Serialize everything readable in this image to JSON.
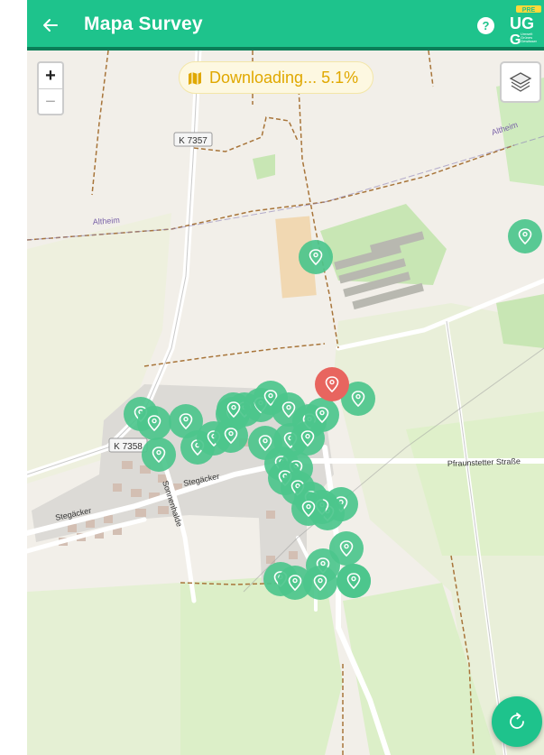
{
  "app": {
    "title": "Mapa Survey",
    "accent_color": "#1ec38c",
    "logo": {
      "badge": "PRE",
      "letters": "UG",
      "letter_g": "G",
      "tagline": "Umwelt Grünes Gewässer"
    }
  },
  "controls": {
    "zoom_in": "+",
    "zoom_out": "−",
    "help": "?",
    "download_status": "Downloading... 5.1%"
  },
  "map_labels": {
    "road_k7357": "K 7357",
    "road_k7358": "K 7358",
    "altheim_w": "Altheim",
    "altheim_ne": "Altheim",
    "pfraunstetter": "Pfraunstetter Straße",
    "stegacker_1": "Stegäcker",
    "stegacker_2": "Stegäcker",
    "sonnenhalde": "Sonnenhalde"
  },
  "markers": {
    "survey_color": "#4cc58c",
    "selected_color": "#e8655f"
  }
}
